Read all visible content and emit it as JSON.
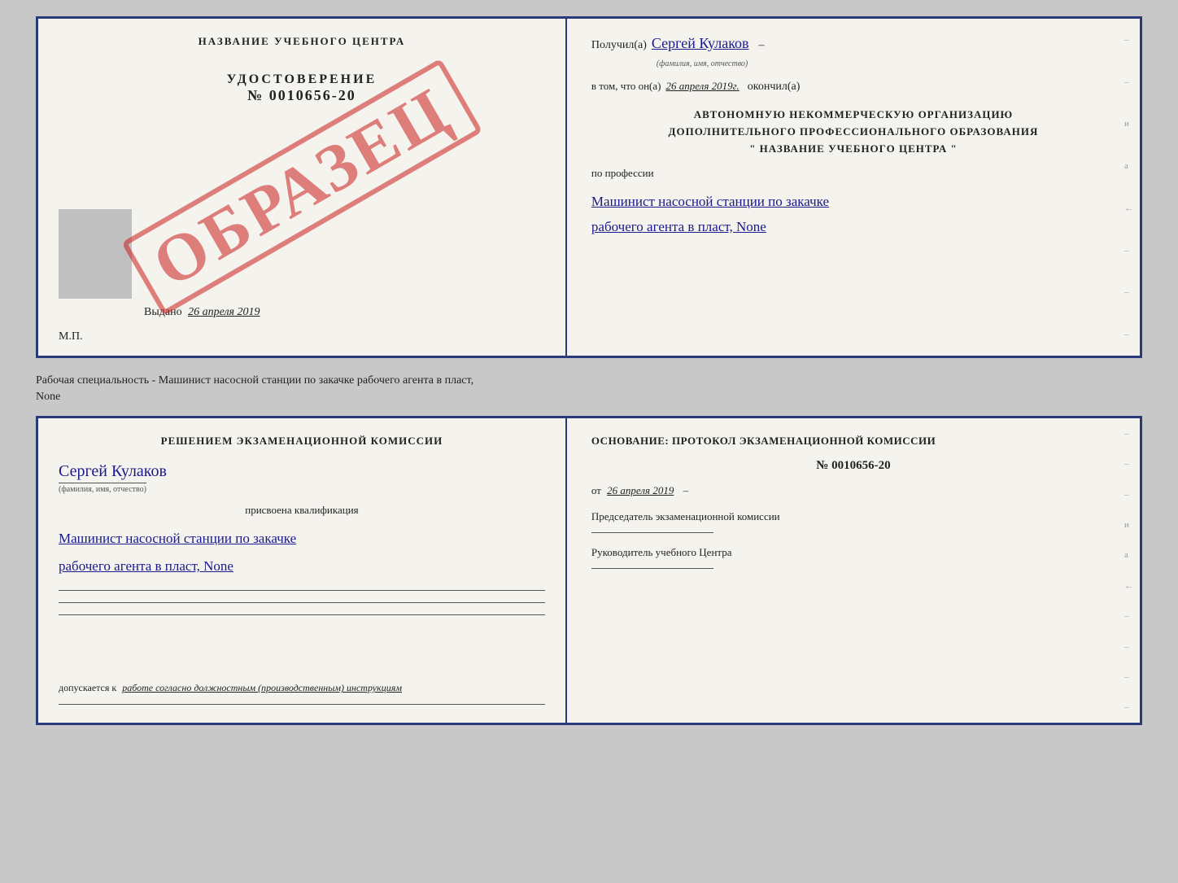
{
  "top_left": {
    "center_title": "НАЗВАНИЕ УЧЕБНОГО ЦЕНТРА",
    "obrazets": "ОБРАЗЕЦ",
    "udostoverenie_label": "УДОСТОВЕРЕНИЕ",
    "udost_number": "№ 0010656-20",
    "vydano_label": "Выдано",
    "vydano_date": "26 апреля 2019",
    "mp_label": "М.П."
  },
  "top_right": {
    "poluchil_label": "Получил(а)",
    "poluchil_name": "Сергей Кулаков",
    "fio_hint": "(фамилия, имя, отчество)",
    "vtom_label": "в том, что он(а)",
    "vtom_date": "26 апреля 2019г.",
    "okonchil_label": "окончил(а)",
    "block_text_1": "АВТОНОМНУЮ НЕКОММЕРЧЕСКУЮ ОРГАНИЗАЦИЮ",
    "block_text_2": "ДОПОЛНИТЕЛЬНОГО ПРОФЕССИОНАЛЬНОГО ОБРАЗОВАНИЯ",
    "block_text_3": "\"   НАЗВАНИЕ УЧЕБНОГО ЦЕНТРА   \"",
    "po_professii": "по профессии",
    "profession_1": "Машинист насосной станции по закачке",
    "profession_2": "рабочего агента в пласт, None",
    "dashes": [
      "-",
      "-",
      "и",
      "а",
      "←",
      "-",
      "-",
      "-"
    ]
  },
  "middle": {
    "text": "Рабочая специальность - Машинист насосной станции по закачке рабочего агента в пласт,",
    "text2": "None"
  },
  "bottom_left": {
    "komissia_title": "Решением экзаменационной комиссии",
    "komissia_name": "Сергей Кулаков",
    "fio_hint": "(фамилия, имя, отчество)",
    "prisvoena": "присвоена квалификация",
    "kvalif_1": "Машинист насосной станции по закачке",
    "kvalif_2": "рабочего агента в пласт, None",
    "dopusk_label": "допускается к",
    "dopusk_text": "работе согласно должностным (производственным) инструкциям"
  },
  "bottom_right": {
    "osnovanie_label": "Основание: протокол экзаменационной комиссии",
    "protocol_number": "№ 0010656-20",
    "ot_label": "от",
    "ot_date": "26 апреля 2019",
    "predsedatel_label": "Председатель экзаменационной комиссии",
    "rukov_label": "Руководитель учебного Центра",
    "dashes": [
      "-",
      "-",
      "-",
      "и",
      "а",
      "←",
      "-",
      "-",
      "-",
      "-"
    ]
  }
}
